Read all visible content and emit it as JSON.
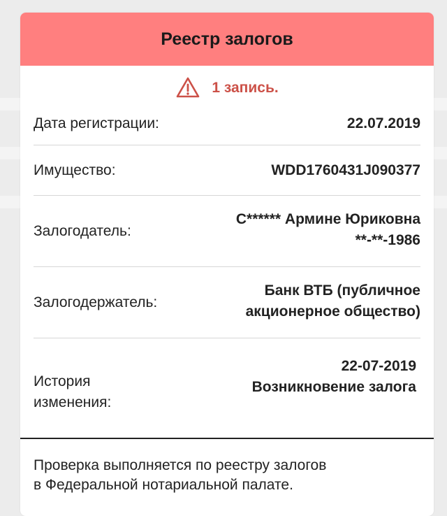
{
  "header": {
    "title": "Реестр залогов"
  },
  "notice": {
    "icon": "warning-triangle-icon",
    "text": "1 запись.",
    "color": "#cc5148"
  },
  "rows": [
    {
      "label": "Дата регистрации:",
      "value": "22.07.2019"
    },
    {
      "label": "Имущество:",
      "value": "WDD1760431J090377"
    },
    {
      "label": "Залогодатель:",
      "value_line1": "С****** Армине Юриковна",
      "value_line2": "**-**-1986"
    },
    {
      "label": "Залогодержатель:",
      "value_line1": "Банк ВТБ (публичное",
      "value_line2": "акционерное общество)"
    },
    {
      "label_line1": "История",
      "label_line2": "изменения:",
      "value_line1": "22-07-2019",
      "value_line2": "Возникновение залога"
    }
  ],
  "footer": {
    "line1": "Проверка выполняется по реестру залогов",
    "line2": "в Федеральной нотариальной палате."
  },
  "colors": {
    "header_bg": "#ff7f7f",
    "page_bg": "#ececec"
  }
}
